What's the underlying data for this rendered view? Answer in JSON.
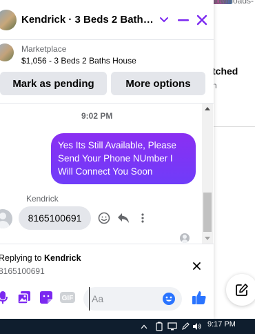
{
  "background_page": {
    "url_fragment": "bitget.downloads-",
    "partial_heading": "tched",
    "partial_text": "n"
  },
  "chat_header": {
    "title": "Kendrick · 3 Beds 2 Baths House",
    "icons": [
      "chevron-down-icon",
      "minimize-icon",
      "close-icon"
    ]
  },
  "listing": {
    "source": "Marketplace",
    "price_title": "$1,056 - 3 Beds 2 Baths House"
  },
  "actions": {
    "mark_pending": "Mark as pending",
    "more_options": "More options"
  },
  "conversation": {
    "timestamp": "9:02 PM",
    "outgoing_message": {
      "lines": [
        "Yes Its Still Available, Please",
        "Send Your Phone NUmber I",
        "Will Connect You Soon"
      ]
    },
    "incoming_sender": "Kendrick",
    "incoming_message": "8165100691"
  },
  "reply_bar": {
    "prefix": "Replying to",
    "name": "Kendrick",
    "quoted": "8165100691"
  },
  "composer": {
    "placeholder": "Aa",
    "icons": [
      "microphone-icon",
      "image-icon",
      "sticker-icon",
      "gif-icon",
      "emoji-icon",
      "thumbs-up-icon"
    ]
  },
  "taskbar": {
    "clock": "9:17 PM"
  },
  "colors": {
    "accent": "#7b28f0",
    "bubble_out_top": "#8a2ff2",
    "bubble_out_bottom": "#6f3cf9",
    "bubble_in": "#e4e6eb",
    "taskbar": "#0f1e2e"
  }
}
